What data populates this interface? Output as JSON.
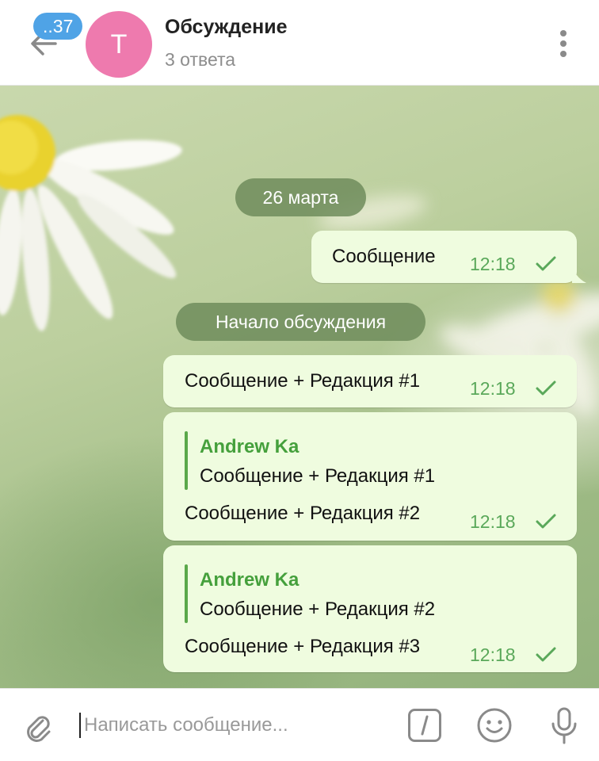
{
  "header": {
    "unread_badge": "..37",
    "avatar_letter": "T",
    "title": "Обсуждение",
    "subtitle": "3 ответа"
  },
  "chat": {
    "date_label": "26 марта",
    "thread_start_label": "Начало обсуждения",
    "messages": [
      {
        "text": "Сообщение",
        "time": "12:18",
        "status": "sent"
      },
      {
        "text": "Сообщение + Редакция #1",
        "time": "12:18",
        "status": "sent"
      },
      {
        "reply_author": "Andrew Ka",
        "reply_text": "Сообщение + Редакция #1",
        "text": "Сообщение + Редакция #2",
        "time": "12:18",
        "status": "sent"
      },
      {
        "reply_author": "Andrew Ka",
        "reply_text": "Сообщение + Редакция #2",
        "text": "Сообщение + Редакция #3",
        "time": "12:18",
        "status": "sent"
      }
    ]
  },
  "composer": {
    "placeholder": "Написать сообщение..."
  },
  "colors": {
    "bubble": "#effcdf",
    "accent_green": "#5aa85a",
    "badge_blue": "#4fa3e6",
    "avatar_pink": "#ee7aae"
  }
}
